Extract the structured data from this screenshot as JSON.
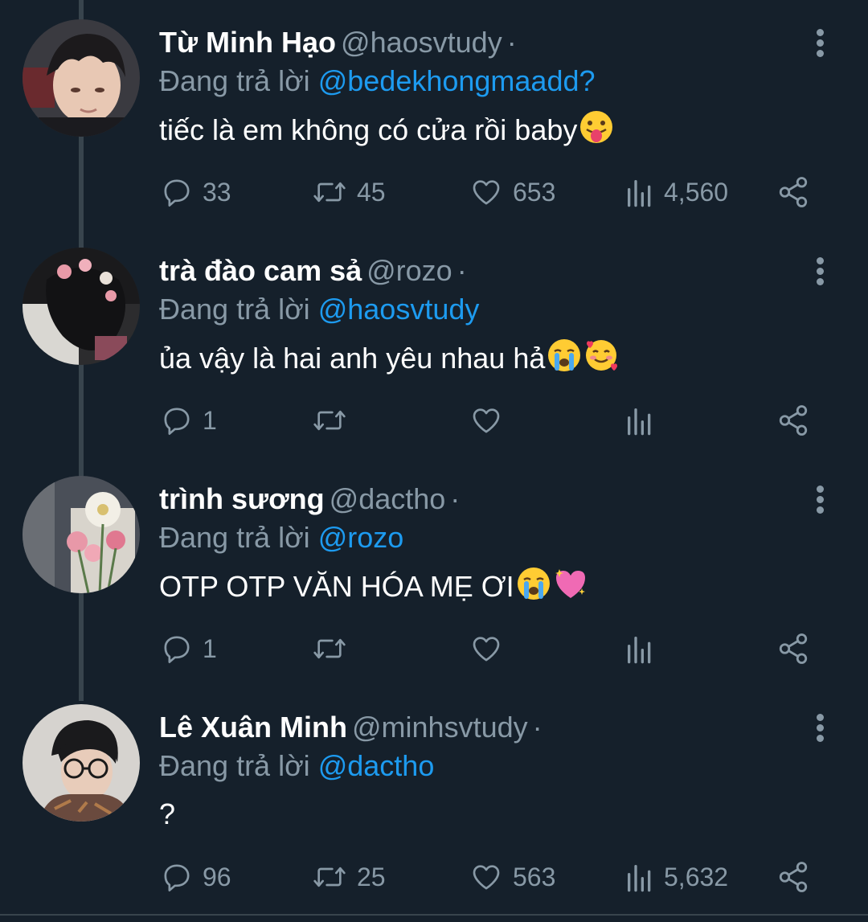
{
  "replying_prefix": "Đang trả lời",
  "colors": {
    "background": "#15202b",
    "secondary_text": "#8899a6",
    "link": "#1d9bf0",
    "thread_line": "#38444d"
  },
  "tweets": [
    {
      "name": "Từ Minh Hạo",
      "handle": "@haosvtudy",
      "separator": "·",
      "replying_to": "@bedekhongmaadd?",
      "text": "tiếc là em không có cửa rồi baby",
      "emojis": [
        "tongue-out-emoji"
      ],
      "replies": "33",
      "retweets": "45",
      "likes": "653",
      "views": "4,560"
    },
    {
      "name": "trà đào cam sả",
      "handle": "@rozo",
      "separator": "·",
      "replying_to": "@haosvtudy",
      "text": "ủa vậy là hai anh yêu nhau hả",
      "emojis": [
        "crying-emoji",
        "smiling-hearts-emoji"
      ],
      "replies": "1",
      "retweets": "",
      "likes": "",
      "views": ""
    },
    {
      "name": "trình sương",
      "handle": "@dactho",
      "separator": "·",
      "replying_to": "@rozo",
      "text": "OTP OTP VĂN HÓA MẸ ƠI",
      "emojis": [
        "crying-emoji",
        "sparkling-heart-emoji"
      ],
      "replies": "1",
      "retweets": "",
      "likes": "",
      "views": ""
    },
    {
      "name": "Lê Xuân Minh",
      "handle": "@minhsvtudy",
      "separator": "·",
      "replying_to": "@dactho",
      "text": "?",
      "emojis": [],
      "replies": "96",
      "retweets": "25",
      "likes": "563",
      "views": "5,632"
    }
  ]
}
